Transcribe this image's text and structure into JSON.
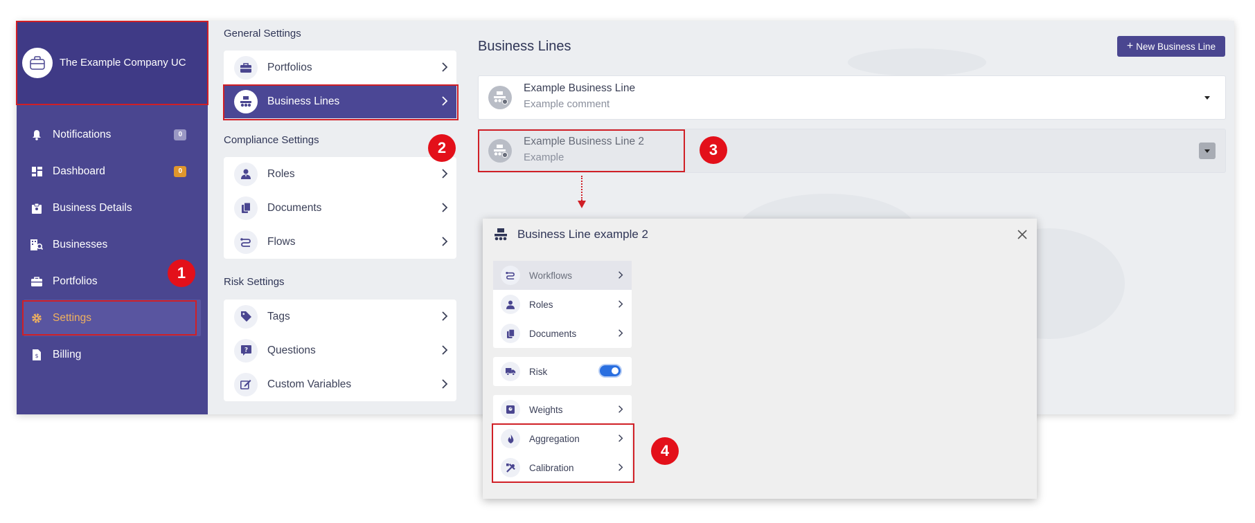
{
  "company": {
    "name": "The Example Company UC"
  },
  "sidebar": {
    "items": [
      {
        "label": "Notifications",
        "icon": "bell-icon",
        "badge": "0",
        "badge_color": "#9a98c4"
      },
      {
        "label": "Dashboard",
        "icon": "dashboard-icon",
        "badge": "0",
        "badge_color": "#e0962c"
      },
      {
        "label": "Business Details",
        "icon": "clipboard-icon"
      },
      {
        "label": "Businesses",
        "icon": "building-search-icon"
      },
      {
        "label": "Portfolios",
        "icon": "briefcase-icon"
      },
      {
        "label": "Settings",
        "icon": "gear-icon",
        "active": true
      },
      {
        "label": "Billing",
        "icon": "invoice-icon"
      }
    ]
  },
  "settings": {
    "general_title": "General Settings",
    "general": [
      {
        "label": "Portfolios",
        "icon": "briefcase-icon"
      },
      {
        "label": "Business Lines",
        "icon": "factory-icon",
        "active": true
      }
    ],
    "compliance_title": "Compliance Settings",
    "compliance": [
      {
        "label": "Roles",
        "icon": "user-tie-icon"
      },
      {
        "label": "Documents",
        "icon": "documents-icon"
      },
      {
        "label": "Flows",
        "icon": "flow-icon"
      }
    ],
    "risk_title": "Risk Settings",
    "risk": [
      {
        "label": "Tags",
        "icon": "tag-icon"
      },
      {
        "label": "Questions",
        "icon": "question-icon"
      },
      {
        "label": "Custom Variables",
        "icon": "edit-icon"
      }
    ]
  },
  "business_lines": {
    "title": "Business Lines",
    "new_button": "New Business Line",
    "items": [
      {
        "name": "Example Business Line",
        "comment": "Example comment"
      },
      {
        "name": "Example Business Line 2",
        "comment": "Example"
      }
    ]
  },
  "modal": {
    "title": "Business Line example 2",
    "group1": [
      {
        "label": "Workflows",
        "icon": "flow-icon"
      },
      {
        "label": "Roles",
        "icon": "user-tie-icon"
      },
      {
        "label": "Documents",
        "icon": "documents-icon"
      }
    ],
    "risk": {
      "label": "Risk",
      "icon": "truck-icon",
      "enabled": true
    },
    "group2": [
      {
        "label": "Weights",
        "icon": "weight-icon"
      },
      {
        "label": "Aggregation",
        "icon": "fire-icon"
      },
      {
        "label": "Calibration",
        "icon": "tools-icon"
      }
    ]
  },
  "annotations": {
    "step1": "1",
    "step2": "2",
    "step3": "3",
    "step4": "4"
  },
  "colors": {
    "sidebar": "#4a4690",
    "accent": "#4b4795",
    "highlight": "#d01f26",
    "active_text": "#f0b15e"
  }
}
